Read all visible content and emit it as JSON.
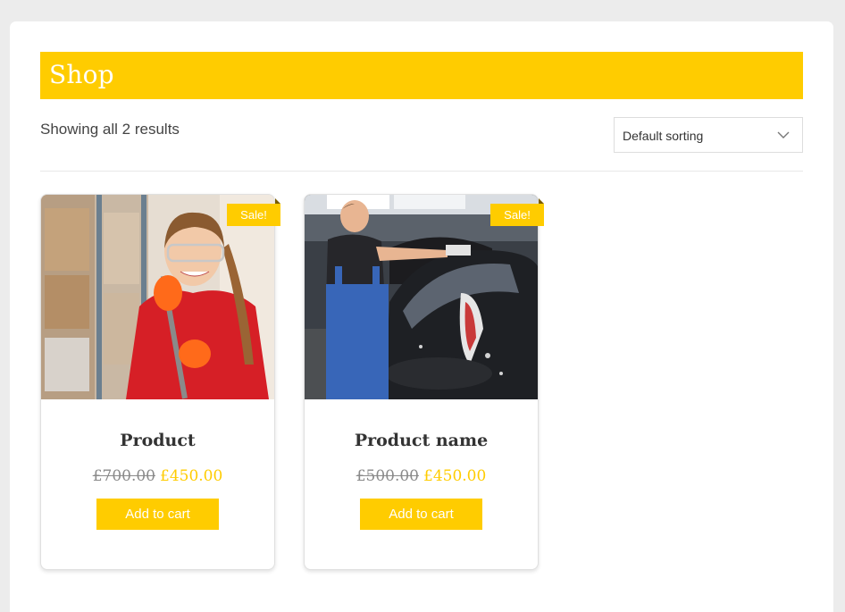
{
  "page": {
    "title": "Shop"
  },
  "toolbar": {
    "results_text": "Showing all 2 results",
    "sort_selected": "Default sorting"
  },
  "products": [
    {
      "name": "Product",
      "old_price": "£700.00",
      "new_price": "£450.00",
      "badge": "Sale!",
      "button": "Add to cart",
      "image": "woman-in-warehouse"
    },
    {
      "name": "Product name",
      "old_price": "£500.00",
      "new_price": "£450.00",
      "badge": "Sale!",
      "button": "Add to cart",
      "image": "man-washing-car"
    }
  ],
  "colors": {
    "accent": "#ffcc00",
    "background": "#ececec",
    "text": "#333333",
    "muted": "#8a8a8a"
  }
}
